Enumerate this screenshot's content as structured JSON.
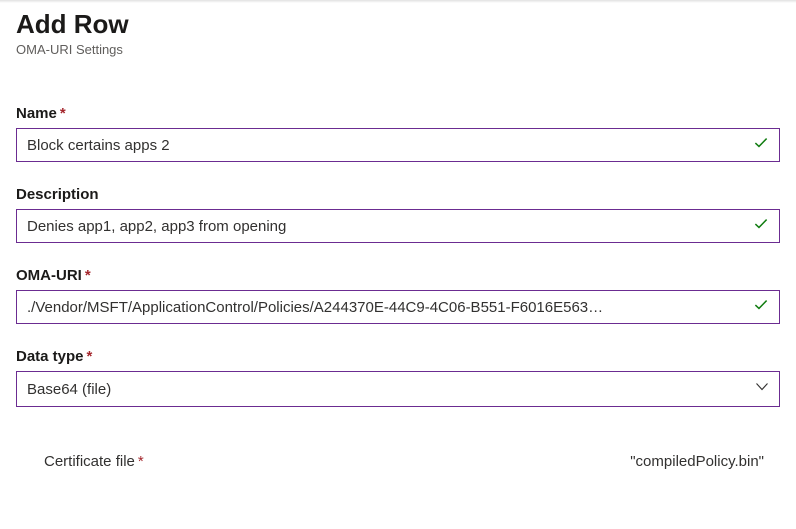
{
  "header": {
    "title": "Add Row",
    "subtitle": "OMA-URI Settings"
  },
  "fields": {
    "name": {
      "label": "Name",
      "required": true,
      "value": "Block certains apps 2",
      "valid": true
    },
    "description": {
      "label": "Description",
      "required": false,
      "value": "Denies app1, app2, app3 from opening",
      "valid": true
    },
    "omauri": {
      "label": "OMA-URI",
      "required": true,
      "value": "./Vendor/MSFT/ApplicationControl/Policies/A244370E-44C9-4C06-B551-F6016E563…",
      "valid": true
    },
    "datatype": {
      "label": "Data type",
      "required": true,
      "selected": "Base64 (file)"
    },
    "certfile": {
      "label": "Certificate file",
      "required": true,
      "filename": "\"compiledPolicy.bin\""
    }
  },
  "requiredMarker": "*",
  "colors": {
    "border": "#6b2c91",
    "required": "#a4262c",
    "check": "#107c10"
  }
}
